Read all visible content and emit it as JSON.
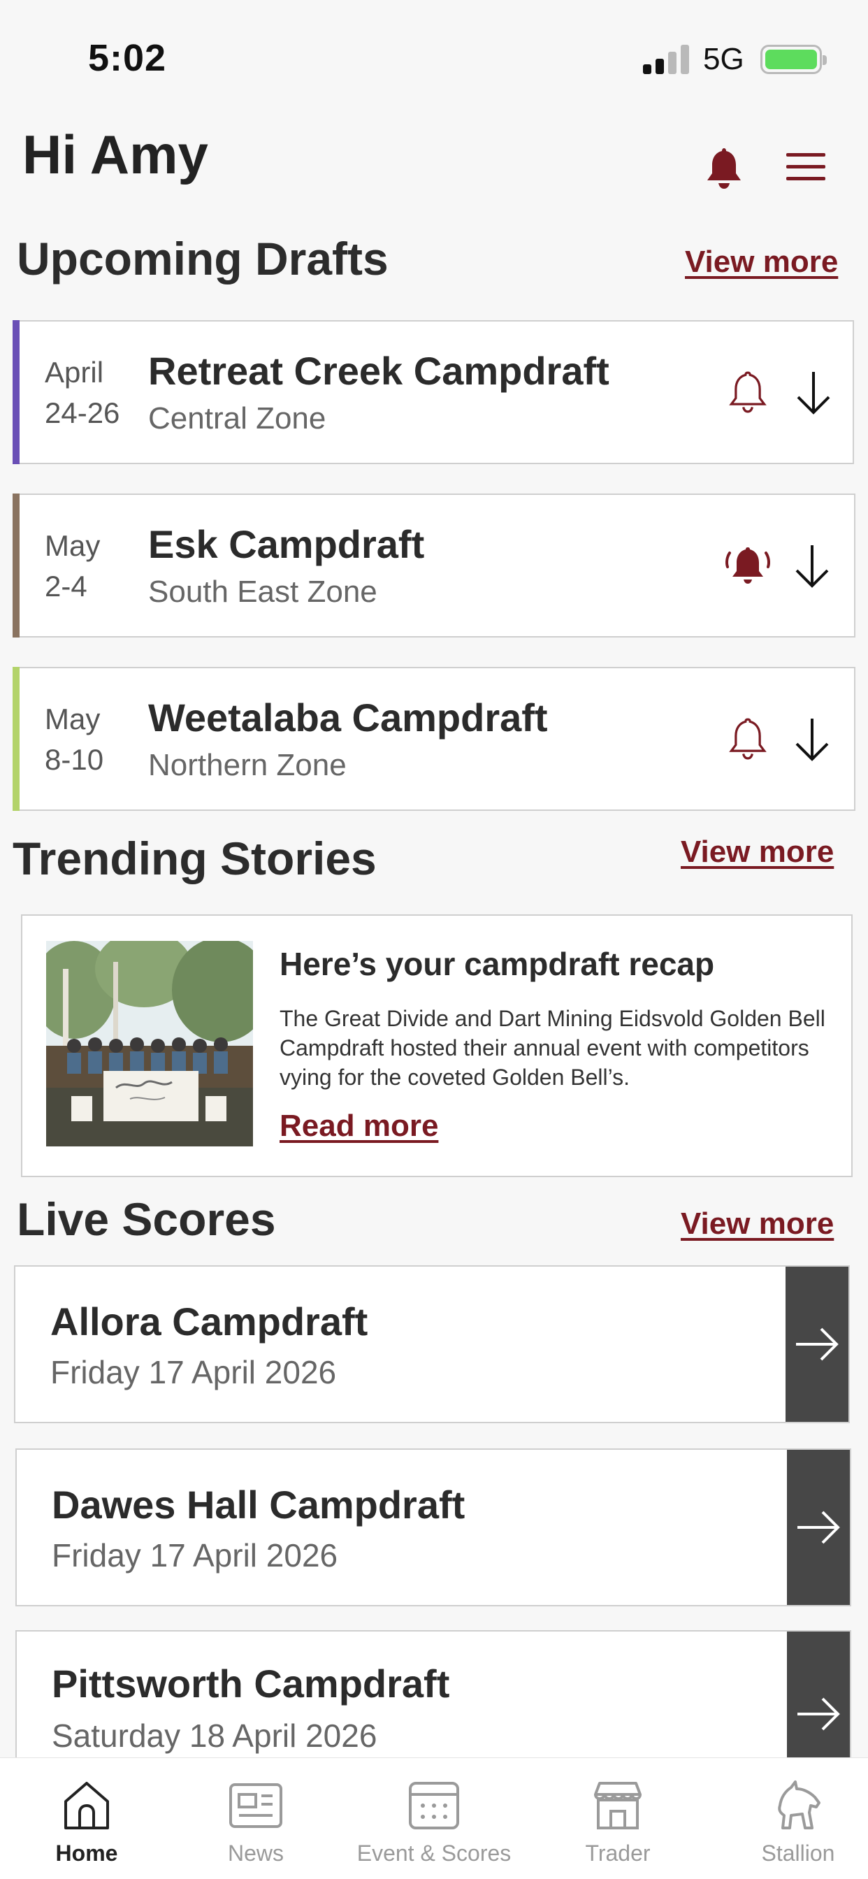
{
  "status_bar": {
    "time": "5:02",
    "network": "5G"
  },
  "header": {
    "greeting": "Hi Amy"
  },
  "upcoming": {
    "title": "Upcoming Drafts",
    "view_more": "View more",
    "items": [
      {
        "month": "April",
        "days": "24-26",
        "name": "Retreat Creek Campdraft",
        "zone": "Central Zone",
        "accent": "#6a4fb6",
        "bell_active": false
      },
      {
        "month": "May",
        "days": "2-4",
        "name": "Esk Campdraft",
        "zone": "South East Zone",
        "accent": "#8a7360",
        "bell_active": true
      },
      {
        "month": "May",
        "days": "8-10",
        "name": "Weetalaba Campdraft",
        "zone": "Northern Zone",
        "accent": "#b3d36a",
        "bell_active": false
      }
    ]
  },
  "trending": {
    "title": "Trending Stories",
    "view_more": "View more",
    "story": {
      "headline": "Here’s your campdraft recap",
      "body": "The Great Divide and Dart Mining Eidsvold Golden Bell Campdraft hosted their annual event with competitors vying for the coveted Golden Bell’s.",
      "read_more": "Read more"
    }
  },
  "live_scores": {
    "title": "Live Scores",
    "view_more": "View more",
    "items": [
      {
        "name": "Allora Campdraft",
        "date": "Friday 17 April 2026"
      },
      {
        "name": "Dawes Hall Campdraft",
        "date": "Friday 17 April 2026"
      },
      {
        "name": "Pittsworth Campdraft",
        "date": "Saturday 18 April 2026"
      }
    ]
  },
  "nav": {
    "items": [
      {
        "label": "Home",
        "icon": "home-icon",
        "active": true
      },
      {
        "label": "News",
        "icon": "news-icon",
        "active": false
      },
      {
        "label": "Event & Scores",
        "icon": "calendar-icon",
        "active": false
      },
      {
        "label": "Trader",
        "icon": "store-icon",
        "active": false
      },
      {
        "label": "Stallion",
        "icon": "horse-icon",
        "active": false
      }
    ]
  },
  "colors": {
    "brand": "#7a1a22",
    "score_button": "#474747",
    "background": "#f7f7f7"
  }
}
